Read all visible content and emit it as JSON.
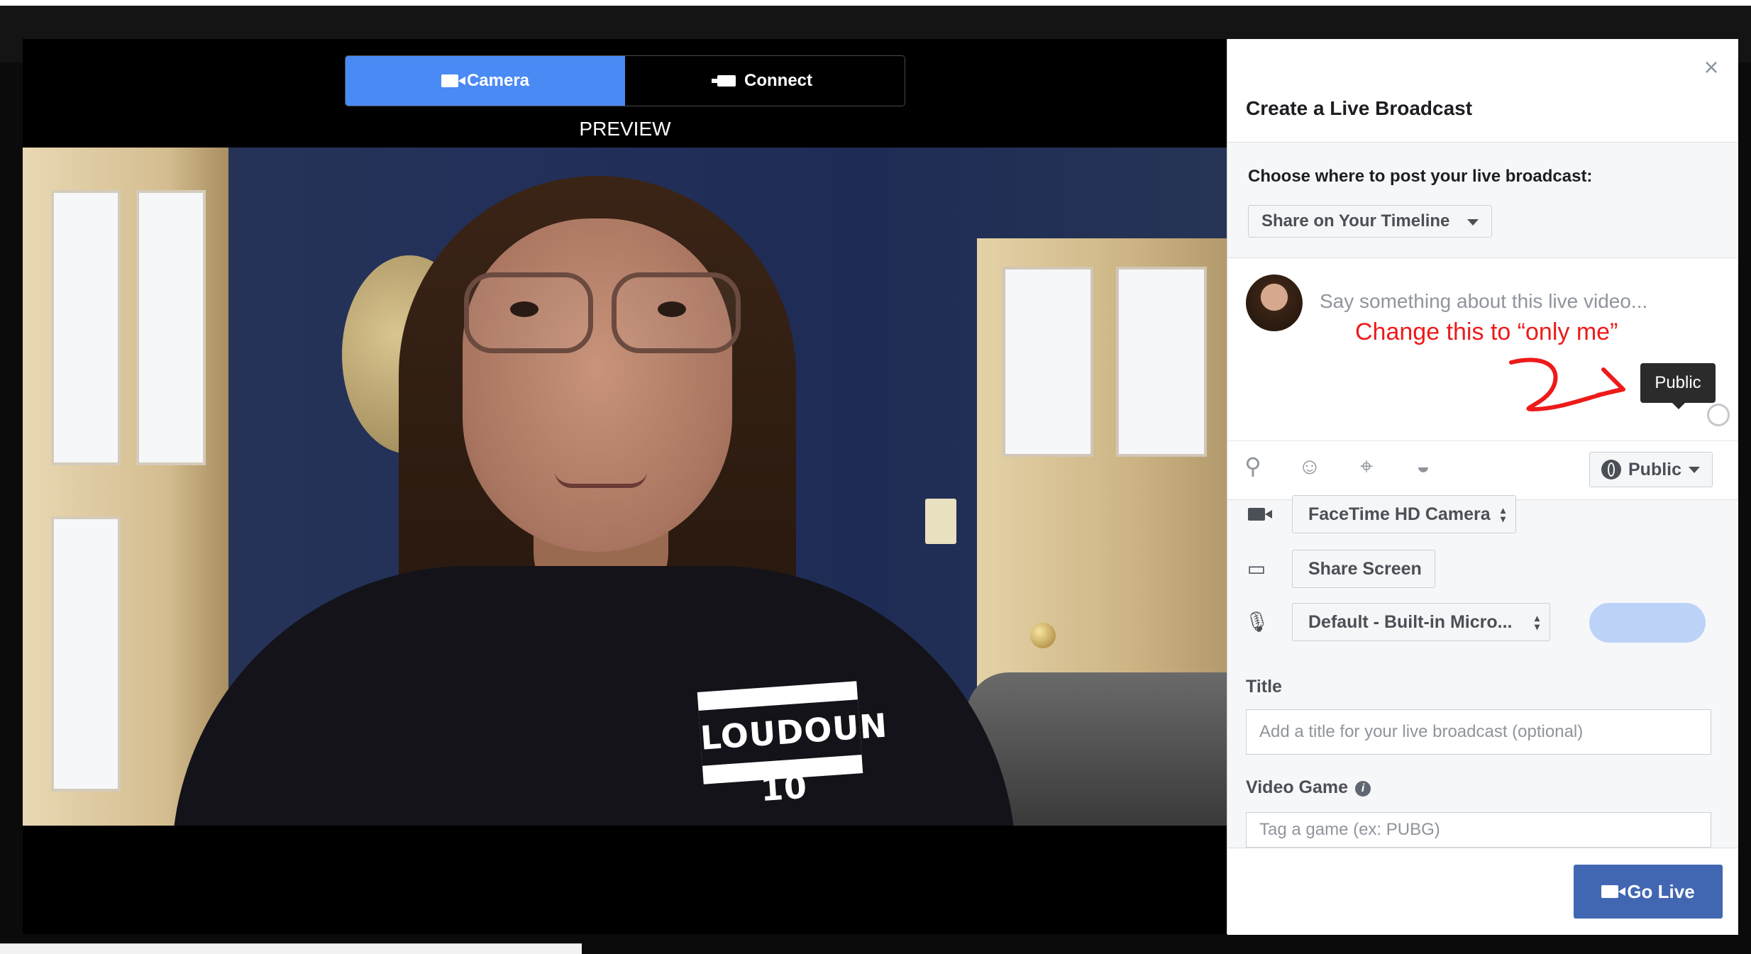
{
  "source_tabs": {
    "camera_label": "Camera",
    "connect_label": "Connect",
    "active": "camera"
  },
  "preview_label": "PREVIEW",
  "scene": {
    "shirt_logo": "LOUDOUN 10"
  },
  "panel": {
    "title": "Create a Live Broadcast",
    "close_icon": "close-icon",
    "choose_label": "Choose where to post your live broadcast:",
    "share_option": "Share on Your Timeline",
    "composer": {
      "placeholder": "Say something about this live video...",
      "annotation": "Change this to “only me”",
      "tooltip": "Public",
      "audience_label": "Public",
      "icons": [
        "tag-people-icon",
        "feeling-icon",
        "location-icon",
        "sticker-icon"
      ]
    },
    "devices": {
      "camera": "FaceTime HD Camera",
      "share_screen": "Share Screen",
      "microphone": "Default - Built-in Micro..."
    },
    "title_label": "Title",
    "title_placeholder": "Add a title for your live broadcast (optional)",
    "game_label": "Video Game",
    "game_placeholder": "Tag a game (ex: PUBG)",
    "go_live_label": "Go Live"
  },
  "colors": {
    "tab_active": "#4a8af4",
    "go_live": "#4267b2",
    "annotation": "#ee1a1a",
    "mic_level": "#bcd2f7"
  }
}
